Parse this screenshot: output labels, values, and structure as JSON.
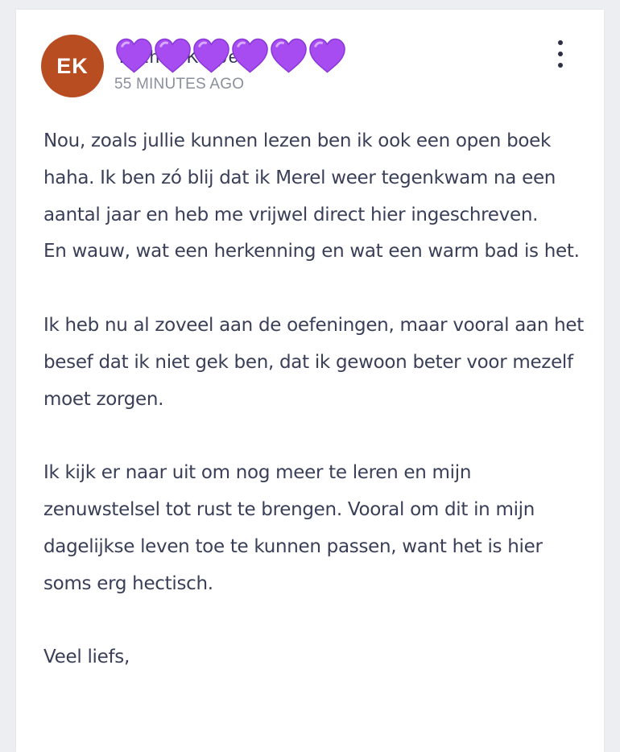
{
  "post": {
    "avatar_initials": "EK",
    "author_name": "Esther Kuipers",
    "author_name_decoration": "six purple hearts covering the name",
    "timestamp": "55 MINUTES AGO",
    "more_menu_icon": "vertical-ellipsis-icon",
    "paragraphs": [
      "Nou, zoals jullie kunnen lezen ben ik ook een open boek haha. Ik ben zó blij dat ik Merel weer tegenkwam na een aantal jaar en heb me vrijwel direct hier ingeschreven.\nEn wauw, wat een herkenning en wat een warm bad is het.",
      "Ik heb nu al zoveel aan de oefeningen, maar vooral aan het besef dat ik niet gek ben, dat ik gewoon beter voor mezelf moet zorgen.",
      "Ik kijk er naar uit om nog meer te leren en mijn zenuwstelsel tot rust te brengen. Vooral om dit in mijn dagelijkse leven toe te kunnen passen, want het is hier soms erg hectisch.",
      "Veel liefs,"
    ]
  },
  "colors": {
    "avatar_bg": "#b94d22",
    "heart": "#a64cf0",
    "text": "#3a3f58",
    "timestamp": "#8b8f9c"
  }
}
